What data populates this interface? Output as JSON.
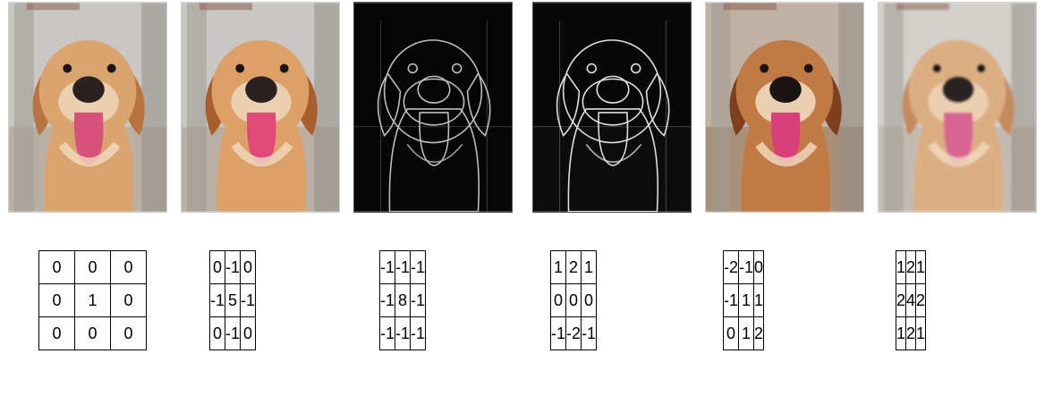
{
  "panels": [
    {
      "image_icon": "dog-photo-original-icon",
      "style": "normal",
      "kernel": [
        [
          "0",
          "0",
          "0"
        ],
        [
          "0",
          "1",
          "0"
        ],
        [
          "0",
          "0",
          "0"
        ]
      ]
    },
    {
      "image_icon": "dog-photo-sharpened-icon",
      "style": "sharpen",
      "kernel": [
        [
          "0",
          "-1",
          "0"
        ],
        [
          "-1",
          "5",
          "-1"
        ],
        [
          "0",
          "-1",
          "0"
        ]
      ]
    },
    {
      "image_icon": "dog-photo-edge-outline-icon",
      "style": "edges",
      "kernel": [
        [
          "-1",
          "-1",
          "-1"
        ],
        [
          "-1",
          "8",
          "-1"
        ],
        [
          "-1",
          "-1",
          "-1"
        ]
      ]
    },
    {
      "image_icon": "dog-photo-sobel-horizontal-icon",
      "style": "sobel",
      "kernel": [
        [
          "1",
          "2",
          "1"
        ],
        [
          "0",
          "0",
          "0"
        ],
        [
          "-1",
          "-2",
          "-1"
        ]
      ]
    },
    {
      "image_icon": "dog-photo-emboss-icon",
      "style": "emboss",
      "kernel": [
        [
          "-2",
          "-1",
          "0"
        ],
        [
          "-1",
          "1",
          "1"
        ],
        [
          "0",
          "1",
          "2"
        ]
      ]
    },
    {
      "image_icon": "dog-photo-blurred-icon",
      "style": "blur",
      "kernel": [
        [
          "1",
          "2",
          "1"
        ],
        [
          "2",
          "4",
          "2"
        ],
        [
          "1",
          "2",
          "1"
        ]
      ]
    }
  ]
}
